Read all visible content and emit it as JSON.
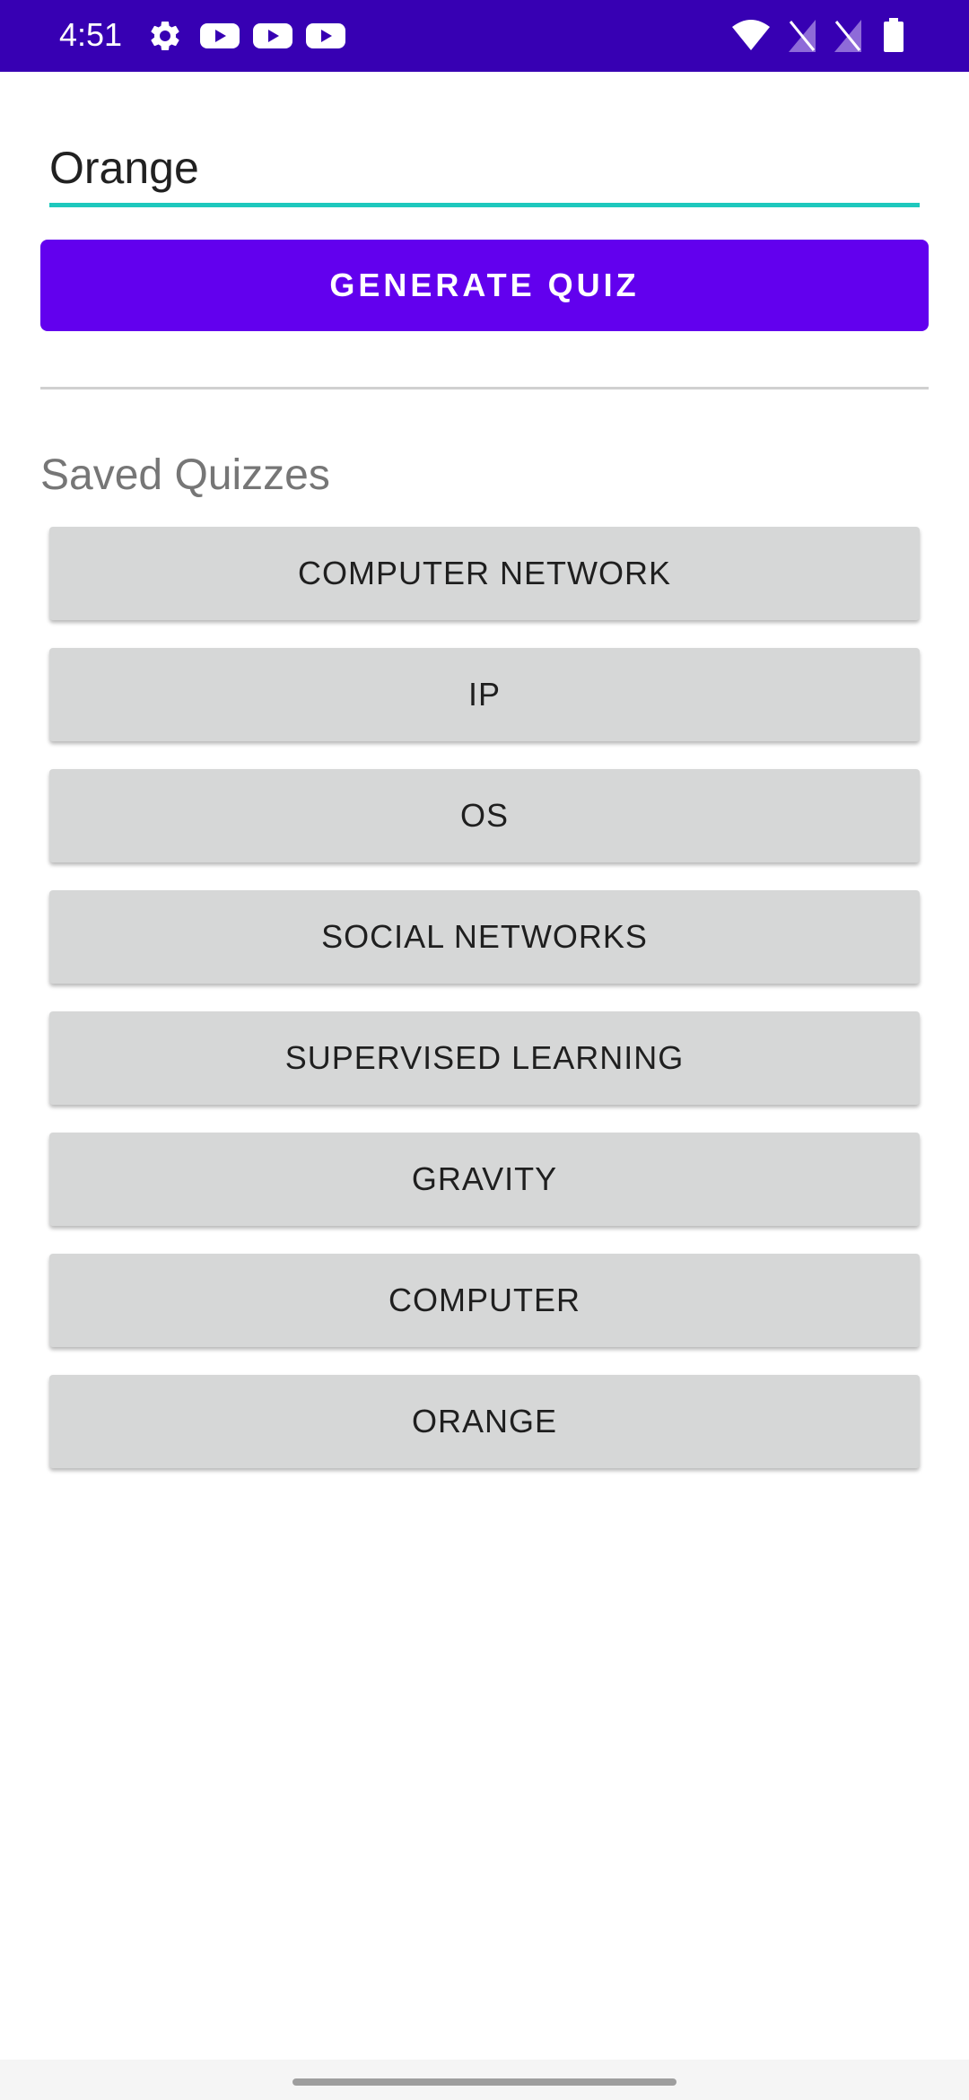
{
  "status_bar": {
    "time": "4:51",
    "icons": [
      "gear-icon",
      "youtube-icon",
      "youtube-icon",
      "youtube-icon",
      "wifi-icon",
      "no-sim-icon",
      "no-sim-icon",
      "battery-icon"
    ],
    "background_color": "#3700b3"
  },
  "topic_input": {
    "value": "Orange",
    "underline_color": "#1ec8bd"
  },
  "generate_button": {
    "label": "GENERATE QUIZ",
    "color": "#6200ee"
  },
  "saved_quizzes": {
    "heading": "Saved Quizzes",
    "items": [
      {
        "label": "COMPUTER NETWORK"
      },
      {
        "label": "IP"
      },
      {
        "label": "OS"
      },
      {
        "label": "SOCIAL NETWORKS"
      },
      {
        "label": "SUPERVISED LEARNING"
      },
      {
        "label": "GRAVITY"
      },
      {
        "label": "COMPUTER"
      },
      {
        "label": "ORANGE"
      }
    ]
  }
}
